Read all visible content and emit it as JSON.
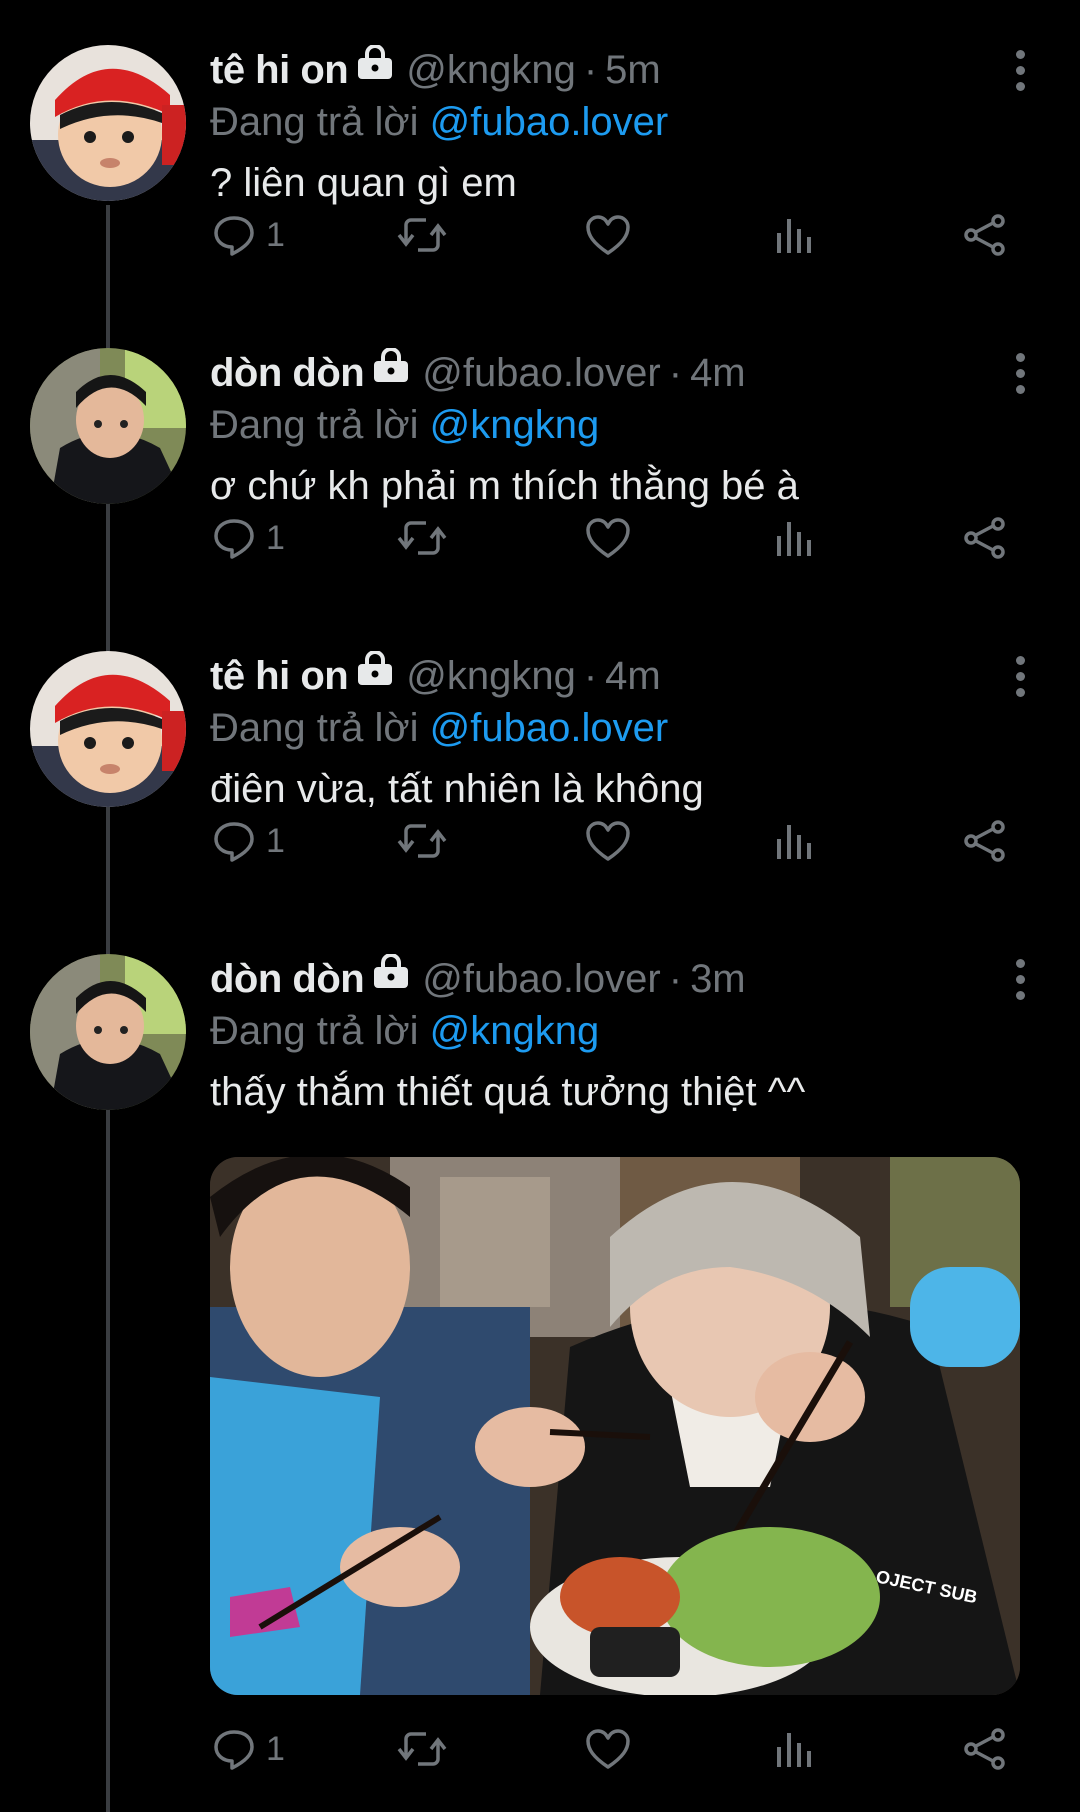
{
  "thread": {
    "replying_prefix": "Đang trả lời",
    "tweets": [
      {
        "name": "tê hi on",
        "handle": "@kngkng",
        "separator": "·",
        "time": "5m",
        "reply_to": "@fubao.lover",
        "text": "? liên quan gì em",
        "reply_count": "1"
      },
      {
        "name": "dòn dòn",
        "handle": "@fubao.lover",
        "separator": "·",
        "time": "4m",
        "reply_to": "@kngkng",
        "text": "ơ chứ kh phải m thích thằng bé à",
        "reply_count": "1"
      },
      {
        "name": "tê hi on",
        "handle": "@kngkng",
        "separator": "·",
        "time": "4m",
        "reply_to": "@fubao.lover",
        "text": "điên vừa, tất nhiên là không",
        "reply_count": "1"
      },
      {
        "name": "dòn dòn",
        "handle": "@fubao.lover",
        "separator": "·",
        "time": "3m",
        "reply_to": "@kngkng",
        "text": "thấy thắm thiết quá tưởng thiệt ^^",
        "reply_count": "1",
        "media_text": "OJECT SUB"
      }
    ]
  },
  "icons": [
    "lock-icon",
    "more-icon",
    "reply-icon",
    "retweet-icon",
    "like-icon",
    "views-icon",
    "share-icon"
  ],
  "colors": {
    "background": "#000000",
    "text": "#e7e9ea",
    "muted": "#71767b",
    "mention": "#1d9bf0",
    "thread_line": "#3a3d41"
  }
}
